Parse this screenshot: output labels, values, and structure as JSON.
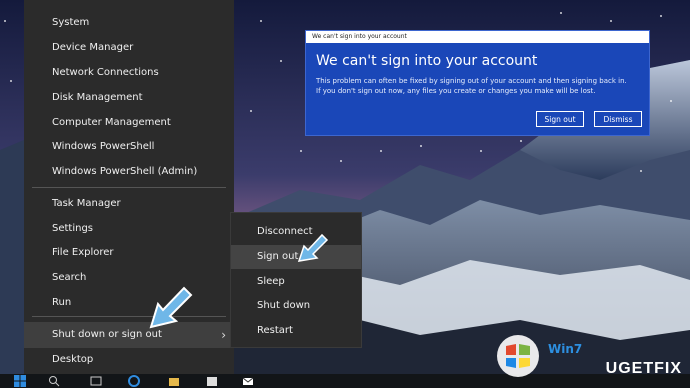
{
  "winx_menu": {
    "items_top": [
      {
        "label": "System"
      },
      {
        "label": "Device Manager"
      },
      {
        "label": "Network Connections"
      },
      {
        "label": "Disk Management"
      },
      {
        "label": "Computer Management"
      },
      {
        "label": "Windows PowerShell"
      },
      {
        "label": "Windows PowerShell (Admin)"
      }
    ],
    "items_middle": [
      {
        "label": "Task Manager"
      },
      {
        "label": "Settings"
      },
      {
        "label": "File Explorer"
      },
      {
        "label": "Search"
      },
      {
        "label": "Run"
      }
    ],
    "shutdown_label": "Shut down or sign out",
    "desktop_label": "Desktop"
  },
  "submenu": {
    "items": [
      {
        "label": "Disconnect"
      },
      {
        "label": "Sign out"
      },
      {
        "label": "Sleep"
      },
      {
        "label": "Shut down"
      },
      {
        "label": "Restart"
      }
    ],
    "hovered": "Sign out"
  },
  "dialog": {
    "titlebar": "We can't sign into your account",
    "heading": "We can't sign into your account",
    "message_line1": "This problem can often be fixed by signing out of your account and then signing back in.",
    "message_line2": "If you don't sign out now, any files you create or changes you make will be lost.",
    "sign_out_button": "Sign out",
    "dismiss_button": "Dismiss"
  },
  "watermark": {
    "brand": "UGETFIX",
    "win7_text": "Win7"
  },
  "colors": {
    "menu_bg": "#2b2b2b",
    "dialog_bg": "#1a47b8",
    "cursor": "#6fb7e8"
  }
}
